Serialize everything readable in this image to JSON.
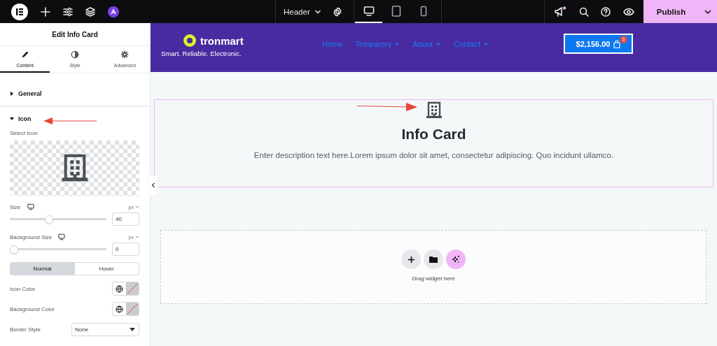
{
  "topbar": {
    "document": {
      "title": "Header"
    },
    "devices": [
      {
        "kind": "desktop",
        "selected": true
      },
      {
        "kind": "tablet",
        "selected": false
      },
      {
        "kind": "mobile",
        "selected": false
      }
    ],
    "has_notification": true,
    "publish": {
      "label": "Publish"
    }
  },
  "panel": {
    "title": "Edit Info Card",
    "tabs": [
      {
        "label": "Content",
        "kind": "pencil",
        "selected": true
      },
      {
        "label": "Style",
        "kind": "contrast",
        "selected": false
      },
      {
        "label": "Advanced",
        "kind": "gear",
        "selected": false
      }
    ],
    "sections": [
      {
        "title": "General",
        "expanded": false
      },
      {
        "title": "Icon",
        "expanded": true
      }
    ],
    "select_icon_label": "Select Icon",
    "sliders": [
      {
        "label": "Size",
        "unit": "px",
        "value": "40",
        "level": 0.4
      },
      {
        "label": "Background Size",
        "unit": "px",
        "value": "0",
        "level": 0
      }
    ],
    "state_tabs": [
      {
        "label": "Normal",
        "selected": true
      },
      {
        "label": "Hover",
        "selected": false
      }
    ],
    "colors": [
      {
        "label": "Icon Color"
      },
      {
        "label": "Background Color"
      }
    ],
    "border_style": {
      "label": "Border Style",
      "value": "None"
    }
  },
  "site_header": {
    "logo_text": "tronmart",
    "tagline": "Smart. Reliable. Electronic.",
    "nav": [
      {
        "label": "Home",
        "has_dropdown": false
      },
      {
        "label": "Temparory",
        "has_dropdown": true
      },
      {
        "label": "About",
        "has_dropdown": true
      },
      {
        "label": "Contact",
        "has_dropdown": true
      }
    ],
    "cart": {
      "amount": "$2,156.00",
      "count": "5"
    }
  },
  "card": {
    "title": "Info Card",
    "description": "Enter description text here.Lorem ipsum dolor sit amet, consectetur adipiscing. Quo incidunt ullamco."
  },
  "dropzone": {
    "hint": "Drag widget here"
  }
}
